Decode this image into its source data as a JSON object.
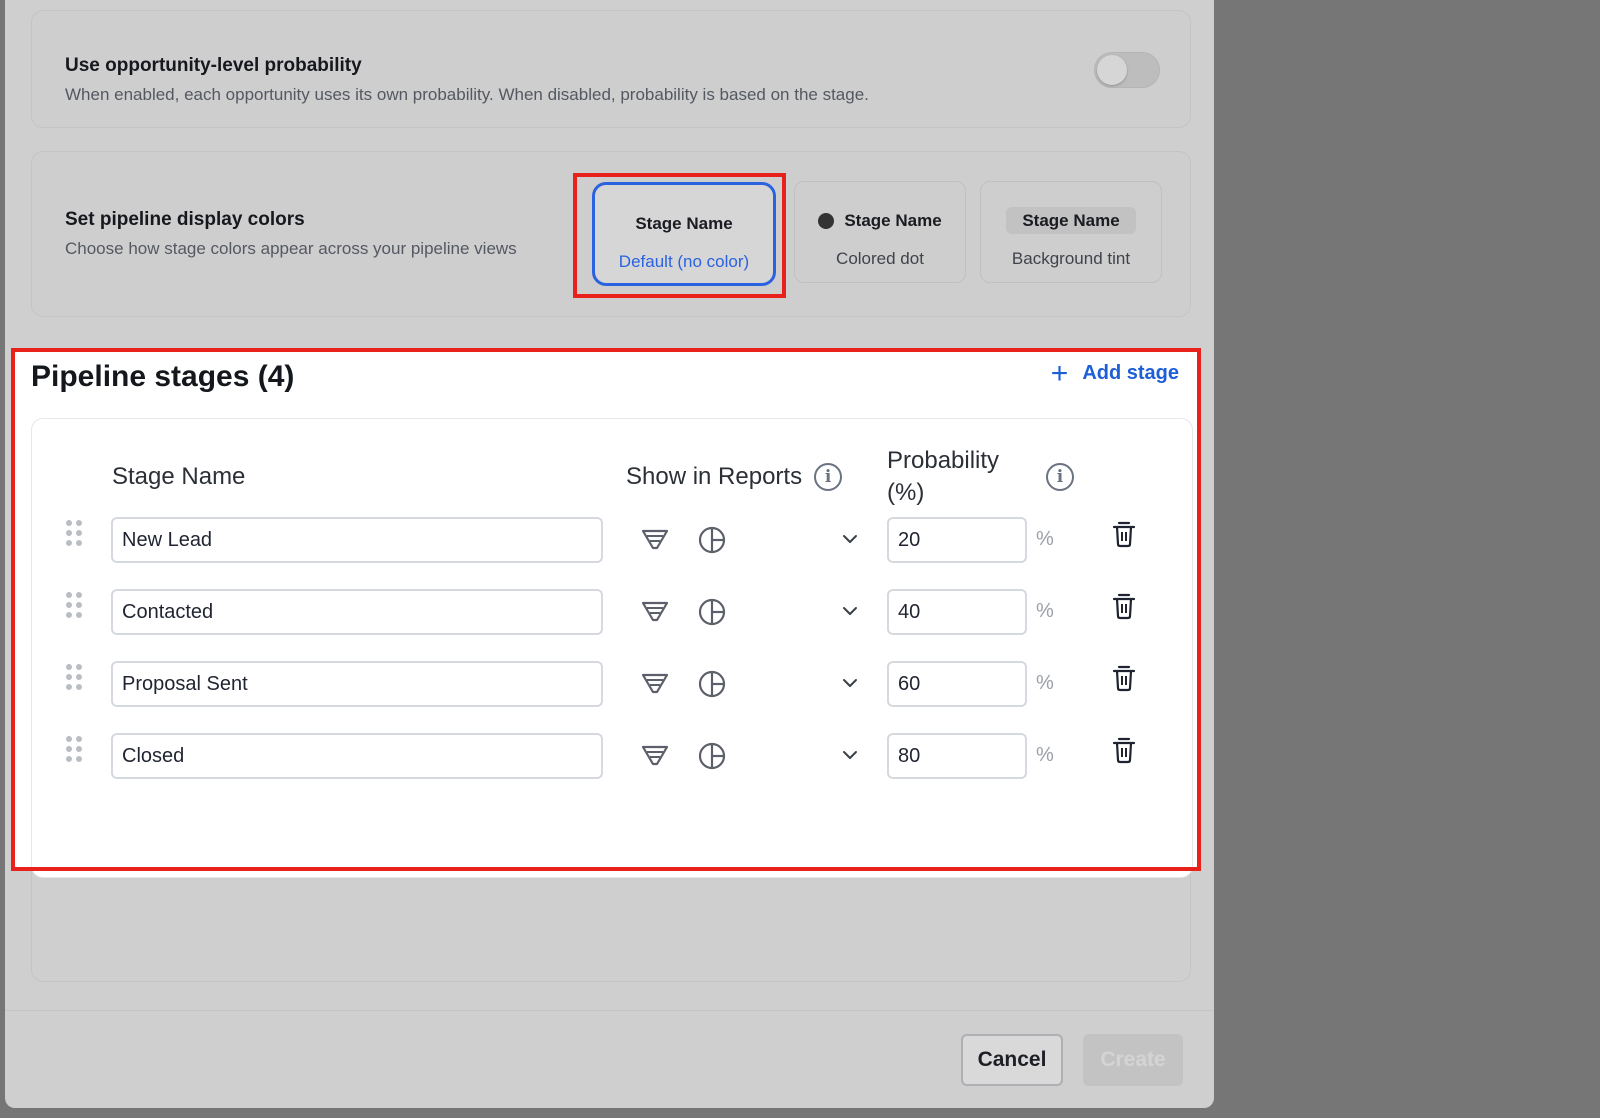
{
  "probability_setting": {
    "title": "Use opportunity-level probability",
    "description": "When enabled, each opportunity uses its own probability. When disabled, probability is based on the stage.",
    "enabled": false
  },
  "display_colors": {
    "title": "Set pipeline display colors",
    "description": "Choose how stage colors appear across your pipeline views",
    "options": [
      {
        "name": "Stage Name",
        "label": "Default (no color)",
        "selected": true
      },
      {
        "name": "Stage Name",
        "label": "Colored dot",
        "selected": false
      },
      {
        "name": "Stage Name",
        "label": "Background tint",
        "selected": false
      }
    ]
  },
  "stages": {
    "title": "Pipeline stages (4)",
    "add_label": "Add stage",
    "headers": {
      "name": "Stage Name",
      "reports": "Show in Reports",
      "probability": "Probability (%)"
    },
    "percent_symbol": "%",
    "rows": [
      {
        "name": "New Lead",
        "probability": "20"
      },
      {
        "name": "Contacted",
        "probability": "40"
      },
      {
        "name": "Proposal Sent",
        "probability": "60"
      },
      {
        "name": "Closed",
        "probability": "80"
      }
    ]
  },
  "footer": {
    "cancel": "Cancel",
    "create": "Create"
  },
  "colors": {
    "accent": "#2b62e0",
    "link": "#1d5fd6",
    "highlight": "#e8221a"
  }
}
